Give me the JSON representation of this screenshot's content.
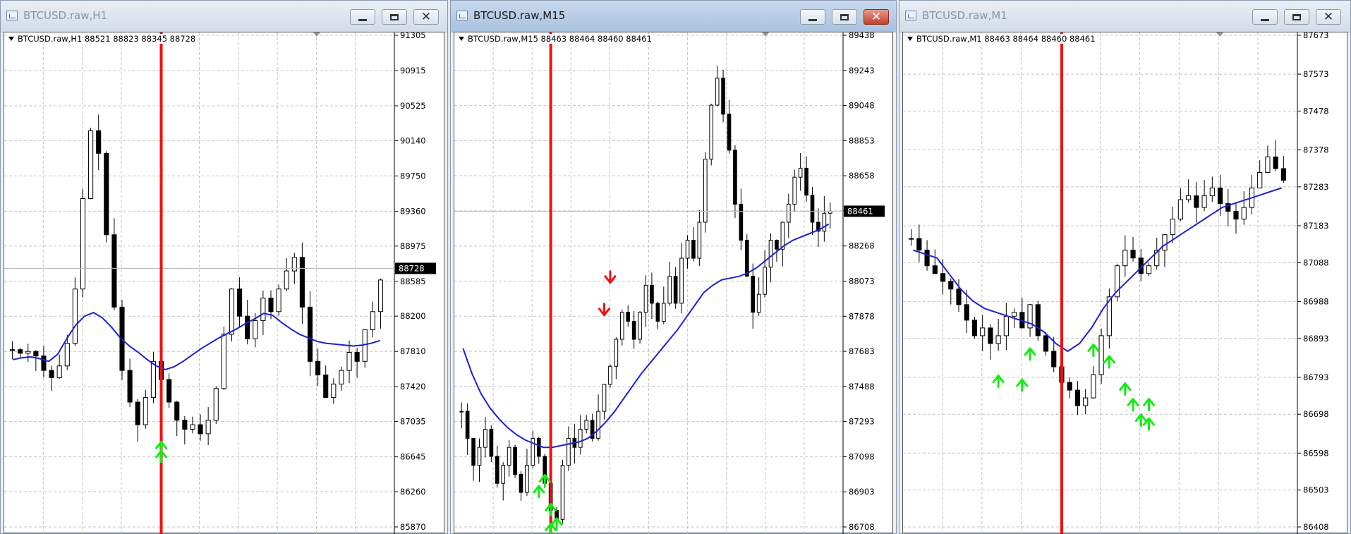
{
  "colors": {
    "candles": "#000000",
    "moving_average": "#1f1fd6",
    "vertical_line": "#ee1111",
    "buy_arrow": "#11ee11",
    "sell_arrow": "#ee1111",
    "grid": "#c4c4c4",
    "price_badge_bg": "#000000"
  },
  "windows": [
    {
      "title": "BTCUSD.raw,H1",
      "active": false,
      "header": "BTCUSD.raw,H1  88521 88823 88345 88728",
      "price_labels": [
        "91305",
        "90915",
        "90525",
        "90140",
        "89750",
        "89360",
        "88975",
        "88585",
        "88200",
        "87810",
        "87420",
        "87035",
        "86645",
        "86260",
        "85870"
      ],
      "current_price": "88728",
      "icons": [
        "window-icon",
        "minimize-icon",
        "maximize-icon",
        "close-icon"
      ]
    },
    {
      "title": "BTCUSD.raw,M15",
      "active": true,
      "header": "BTCUSD.raw,M15  88463 88464 88460 88461",
      "price_labels": [
        "89438",
        "89243",
        "89048",
        "88853",
        "88658",
        "88463",
        "88268",
        "88073",
        "87878",
        "87683",
        "87488",
        "87293",
        "87098",
        "86903",
        "86708"
      ],
      "current_price": "88461",
      "icons": [
        "window-icon",
        "minimize-icon",
        "maximize-icon",
        "close-icon"
      ]
    },
    {
      "title": "BTCUSD.raw,M1",
      "active": false,
      "header": "BTCUSD.raw,M1  88463 88464 88460 88461",
      "price_labels": [
        "87673",
        "87573",
        "87478",
        "87378",
        "87283",
        "87183",
        "87088",
        "86988",
        "86893",
        "86793",
        "86698",
        "86598",
        "86503",
        "86408"
      ],
      "current_price": "",
      "icons": [
        "window-icon",
        "minimize-icon",
        "maximize-icon",
        "close-icon"
      ]
    }
  ],
  "chart_data": [
    {
      "type": "candlestick",
      "symbol": "BTCUSD.raw",
      "timeframe": "H1",
      "ylim": [
        85870,
        91305
      ],
      "close_series": [
        87830,
        87790,
        87810,
        87760,
        87600,
        87520,
        87650,
        87900,
        88500,
        89500,
        90250,
        90000,
        89100,
        88300,
        87600,
        87250,
        87000,
        87300,
        87700,
        87500,
        87250,
        87050,
        86950,
        87000,
        86900,
        87050,
        87400,
        88000,
        88500,
        88200,
        87950,
        88150,
        88400,
        88250,
        88500,
        88700,
        88850,
        88300,
        87700,
        87550,
        87300,
        87450,
        87600,
        87800,
        87700,
        88050,
        88250,
        88600
      ],
      "ma_series": [
        87720,
        87740,
        87750,
        87730,
        87700,
        87780,
        87950,
        88100,
        88200,
        88240,
        88180,
        88080,
        87960,
        87870,
        87800,
        87720,
        87650,
        87610,
        87640,
        87700,
        87770,
        87840,
        87900,
        87960,
        88010,
        88060,
        88120,
        88170,
        88230,
        88210,
        88130,
        88060,
        88000,
        87960,
        87920,
        87900,
        87890,
        87880,
        87870,
        87880,
        87900,
        87930
      ],
      "vertical_line_index": 19,
      "buy_arrows": [
        {
          "index": 19,
          "price": 86780
        },
        {
          "index": 19,
          "price": 86680
        }
      ],
      "sell_arrows": []
    },
    {
      "type": "candlestick",
      "symbol": "BTCUSD.raw",
      "timeframe": "M15",
      "ylim": [
        86708,
        89438
      ],
      "close_series": [
        87350,
        87200,
        87050,
        87150,
        87250,
        87100,
        86950,
        87050,
        87150,
        87000,
        86900,
        87050,
        87200,
        87100,
        86950,
        86800,
        86750,
        87050,
        87200,
        87150,
        87250,
        87300,
        87200,
        87350,
        87500,
        87600,
        87750,
        87900,
        87850,
        87750,
        87900,
        88050,
        87950,
        87850,
        87950,
        88100,
        87950,
        88200,
        88300,
        88200,
        88400,
        88750,
        89050,
        89200,
        89000,
        88800,
        88500,
        88300,
        88100,
        87900,
        88000,
        88150,
        88300,
        88250,
        88400,
        88500,
        88650,
        88700,
        88550,
        88400,
        88350,
        88450,
        88461
      ],
      "ma_series": [
        87700,
        87560,
        87450,
        87370,
        87310,
        87260,
        87220,
        87190,
        87170,
        87150,
        87150,
        87160,
        87170,
        87180,
        87200,
        87240,
        87290,
        87350,
        87420,
        87490,
        87560,
        87620,
        87680,
        87740,
        87800,
        87870,
        87940,
        88010,
        88050,
        88080,
        88090,
        88100,
        88120,
        88150,
        88190,
        88230,
        88270,
        88300,
        88320,
        88340,
        88360,
        88390
      ],
      "vertical_line_index": 15,
      "buy_arrows": [
        {
          "index": 14,
          "price": 86980
        },
        {
          "index": 13,
          "price": 86920
        },
        {
          "index": 15,
          "price": 86820
        },
        {
          "index": 16,
          "price": 86740
        },
        {
          "index": 15,
          "price": 86710
        }
      ],
      "sell_arrows": [
        {
          "index": 25,
          "price": 88080
        },
        {
          "index": 24,
          "price": 87900
        }
      ]
    },
    {
      "type": "candlestick",
      "symbol": "BTCUSD.raw",
      "timeframe": "M1",
      "ylim": [
        86408,
        87673
      ],
      "close_series": [
        87150,
        87120,
        87080,
        87060,
        87040,
        87020,
        86980,
        86940,
        86900,
        86920,
        86880,
        86900,
        86950,
        86960,
        86920,
        86980,
        86900,
        86860,
        86820,
        86780,
        86760,
        86720,
        86740,
        86800,
        86900,
        87000,
        87080,
        87120,
        87100,
        87060,
        87080,
        87120,
        87160,
        87200,
        87250,
        87260,
        87230,
        87260,
        87280,
        87240,
        87220,
        87200,
        87230,
        87280,
        87320,
        87360,
        87330,
        87300
      ],
      "ma_series": [
        87120,
        87110,
        87100,
        87060,
        87020,
        86990,
        86970,
        86960,
        86950,
        86940,
        86930,
        86910,
        86880,
        86860,
        86880,
        86920,
        86970,
        87010,
        87040,
        87070,
        87100,
        87130,
        87150,
        87170,
        87190,
        87210,
        87230,
        87240,
        87250,
        87260,
        87270,
        87280
      ],
      "vertical_line_index": 19,
      "buy_arrows": [
        {
          "index": 11,
          "price": 86790
        },
        {
          "index": 14,
          "price": 86780
        },
        {
          "index": 15,
          "price": 86860
        },
        {
          "index": 23,
          "price": 86870
        },
        {
          "index": 25,
          "price": 86840
        },
        {
          "index": 27,
          "price": 86770
        },
        {
          "index": 28,
          "price": 86730
        },
        {
          "index": 30,
          "price": 86730
        },
        {
          "index": 29,
          "price": 86690
        },
        {
          "index": 30,
          "price": 86680
        }
      ],
      "sell_arrows": []
    }
  ]
}
